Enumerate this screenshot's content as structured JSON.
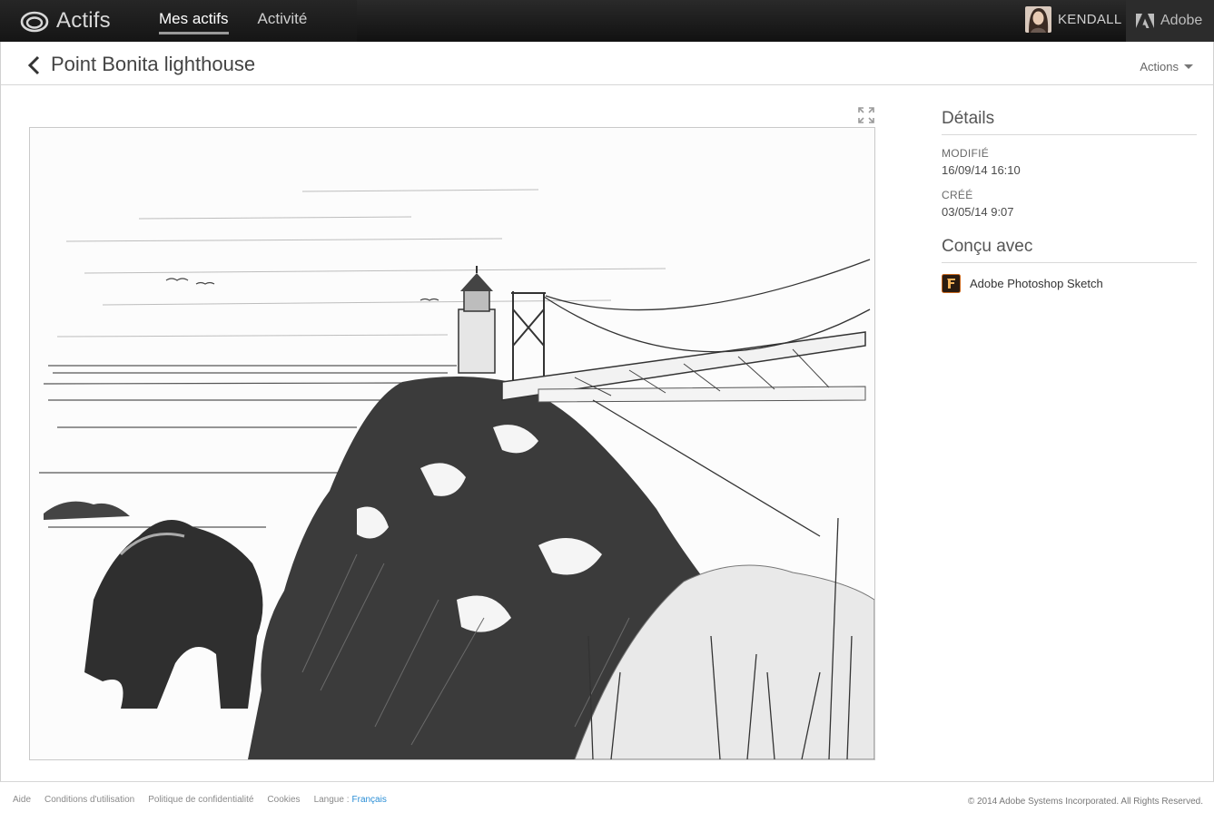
{
  "topbar": {
    "app_title": "Actifs",
    "nav": [
      {
        "label": "Mes actifs",
        "active": true
      },
      {
        "label": "Activité",
        "active": false
      }
    ],
    "user_name": "KENDALL",
    "adobe_label": "Adobe"
  },
  "header": {
    "title": "Point Bonita lighthouse",
    "actions_label": "Actions"
  },
  "details": {
    "title": "Détails",
    "modified_label": "MODIFIÉ",
    "modified_value": "16/09/14 16:10",
    "created_label": "CRÉÉ",
    "created_value": "03/05/14 9:07",
    "made_with_title": "Conçu avec",
    "app_name": "Adobe Photoshop Sketch"
  },
  "footer": {
    "links": [
      "Aide",
      "Conditions d'utilisation",
      "Politique de confidentialité",
      "Cookies"
    ],
    "language_label": "Langue :",
    "language_value": "Français",
    "copyright": "© 2014 Adobe Systems Incorporated. All Rights Reserved."
  },
  "colors": {
    "topbar": "#1b1b1b",
    "link_blue": "#2a8ed6",
    "divider": "#d6d6d6"
  },
  "icons": {
    "brand": "creative-cloud-icon",
    "back": "chevron-left-icon",
    "actions": "caret-down-icon",
    "expand": "fullscreen-icon",
    "app": "photoshop-sketch-icon",
    "adobe": "adobe-logo-icon"
  }
}
